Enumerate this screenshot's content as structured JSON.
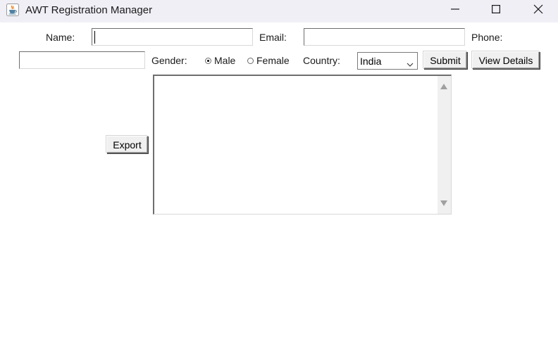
{
  "window": {
    "title": "AWT Registration Manager"
  },
  "form": {
    "name_label": "Name:",
    "name_value": "",
    "email_label": "Email:",
    "email_value": "",
    "phone_label": "Phone:",
    "phone_value": "",
    "gender_label": "Gender:",
    "gender_options": [
      {
        "label": "Male",
        "selected": true
      },
      {
        "label": "Female",
        "selected": false
      }
    ],
    "country_label": "Country:",
    "country_selected": "India",
    "submit_label": "Submit",
    "view_details_label": "View Details",
    "export_label": "Export",
    "details_text": ""
  },
  "icons": {
    "app": "java-cup-icon",
    "minimize": "minimize-icon",
    "maximize": "maximize-icon",
    "close": "close-icon",
    "dropdown": "chevron-down-icon",
    "scroll_up": "triangle-up-icon",
    "scroll_down": "triangle-down-icon"
  }
}
